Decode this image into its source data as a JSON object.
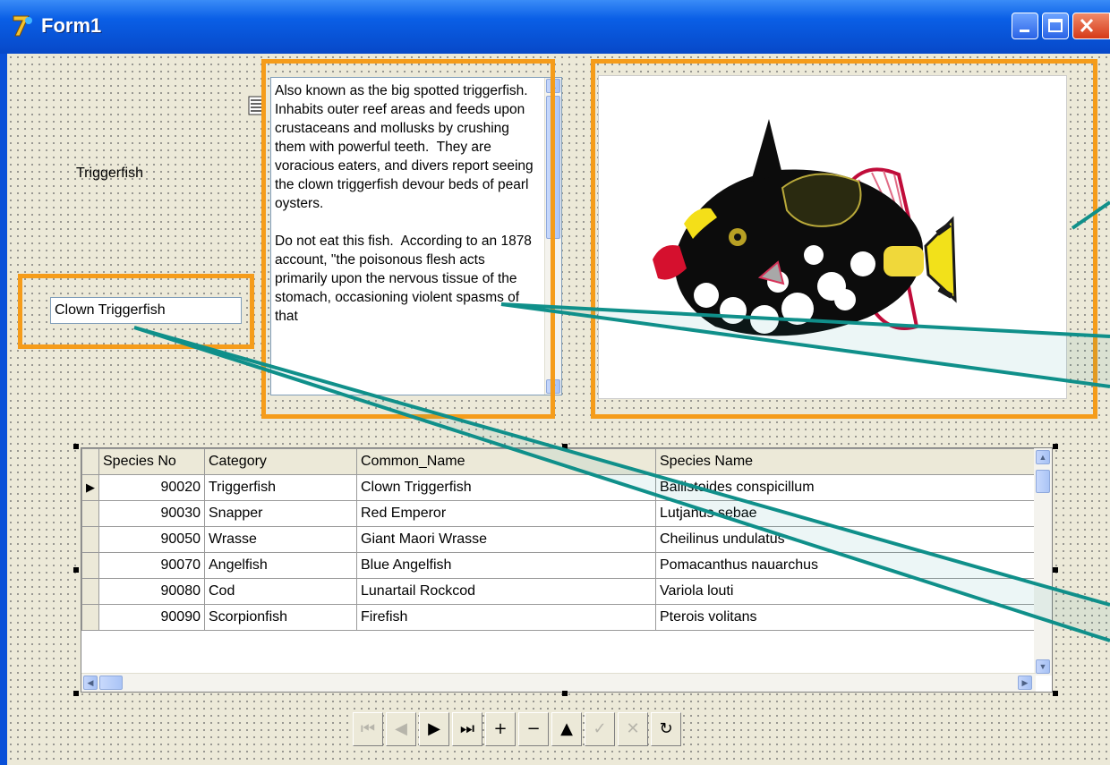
{
  "window": {
    "title": "Form1"
  },
  "form": {
    "label_category": "Triggerfish",
    "edit_common_name": "Clown Triggerfish",
    "memo_text": "Also known as the big spotted triggerfish. Inhabits outer reef areas and feeds upon crustaceans and mollusks by crushing them with powerful teeth.  They are voracious eaters, and divers report seeing the clown triggerfish devour beds of pearl oysters.\n\nDo not eat this fish.  According to an 1878 account, \"the poisonous flesh acts primarily upon the nervous tissue of the stomach, occasioning violent spasms of that"
  },
  "grid": {
    "columns": [
      "Species No",
      "Category",
      "Common_Name",
      "Species Name"
    ],
    "rows": [
      [
        "90020",
        "Triggerfish",
        "Clown Triggerfish",
        "Ballistoides conspicillum"
      ],
      [
        "90030",
        "Snapper",
        "Red Emperor",
        "Lutjanus sebae"
      ],
      [
        "90050",
        "Wrasse",
        "Giant Maori Wrasse",
        "Cheilinus undulatus"
      ],
      [
        "90070",
        "Angelfish",
        "Blue Angelfish",
        "Pomacanthus nauarchus"
      ],
      [
        "90080",
        "Cod",
        "Lunartail Rockcod",
        "Variola louti"
      ],
      [
        "90090",
        "Scorpionfish",
        "Firefish",
        "Pterois volitans"
      ]
    ],
    "current_row_indicator": "▶"
  },
  "navigator": {
    "buttons": [
      {
        "name": "first",
        "glyph": "⏮",
        "enabled": false
      },
      {
        "name": "prior",
        "glyph": "◀",
        "enabled": false
      },
      {
        "name": "next",
        "glyph": "▶",
        "enabled": true
      },
      {
        "name": "last",
        "glyph": "⏭",
        "enabled": true
      },
      {
        "name": "insert",
        "glyph": "+",
        "enabled": true
      },
      {
        "name": "delete",
        "glyph": "−",
        "enabled": true
      },
      {
        "name": "edit",
        "glyph": "▲",
        "enabled": true
      },
      {
        "name": "post",
        "glyph": "✓",
        "enabled": false
      },
      {
        "name": "cancel",
        "glyph": "✕",
        "enabled": false
      },
      {
        "name": "refresh",
        "glyph": "↻",
        "enabled": true
      }
    ]
  },
  "colors": {
    "highlight": "#f59c1a",
    "callout": "#10908a",
    "title_bar": "#0a5fe6"
  },
  "icons": {
    "app": "delphi-app-icon",
    "image": "clown-triggerfish-image",
    "db_component": "data-component-icon"
  }
}
